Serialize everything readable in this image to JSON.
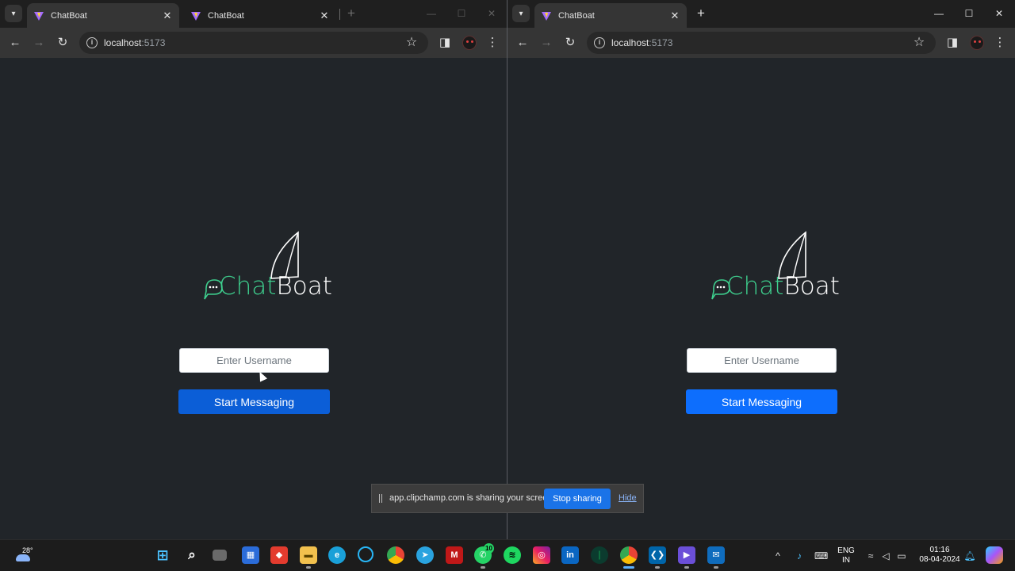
{
  "windows": [
    {
      "tabs": [
        {
          "title": "ChatBoat",
          "active": true
        },
        {
          "title": "ChatBoat",
          "active": false
        }
      ],
      "url_host": "localhost",
      "url_port": ":5173"
    },
    {
      "tabs": [
        {
          "title": "ChatBoat",
          "active": true
        }
      ],
      "url_host": "localhost",
      "url_port": ":5173"
    }
  ],
  "app": {
    "logo_chat": "Chat",
    "logo_boat": "Boat",
    "username_placeholder": "Enter Username",
    "start_button": "Start Messaging"
  },
  "share_bar": {
    "message": "app.clipchamp.com is sharing your screen.",
    "stop_label": "Stop sharing",
    "hide_label": "Hide"
  },
  "taskbar": {
    "weather_temp": "28°",
    "whatsapp_badge": "10",
    "language_line1": "ENG",
    "language_line2": "IN",
    "time": "01:16",
    "date": "08-04-2024",
    "apps": [
      "start-menu",
      "search",
      "task-view",
      "microsoft-store",
      "anydesk",
      "file-explorer",
      "edge",
      "alexa",
      "chrome",
      "telegram",
      "mcafee",
      "whatsapp",
      "spotify",
      "instagram",
      "linkedin",
      "mongodb-compass",
      "chrome-active",
      "vscode",
      "clipchamp",
      "mail"
    ]
  },
  "colors": {
    "page_bg": "#212529",
    "logo_green": "#3ecf8e",
    "button_blue": "#0d6efd",
    "share_blue": "#1a73e8"
  }
}
